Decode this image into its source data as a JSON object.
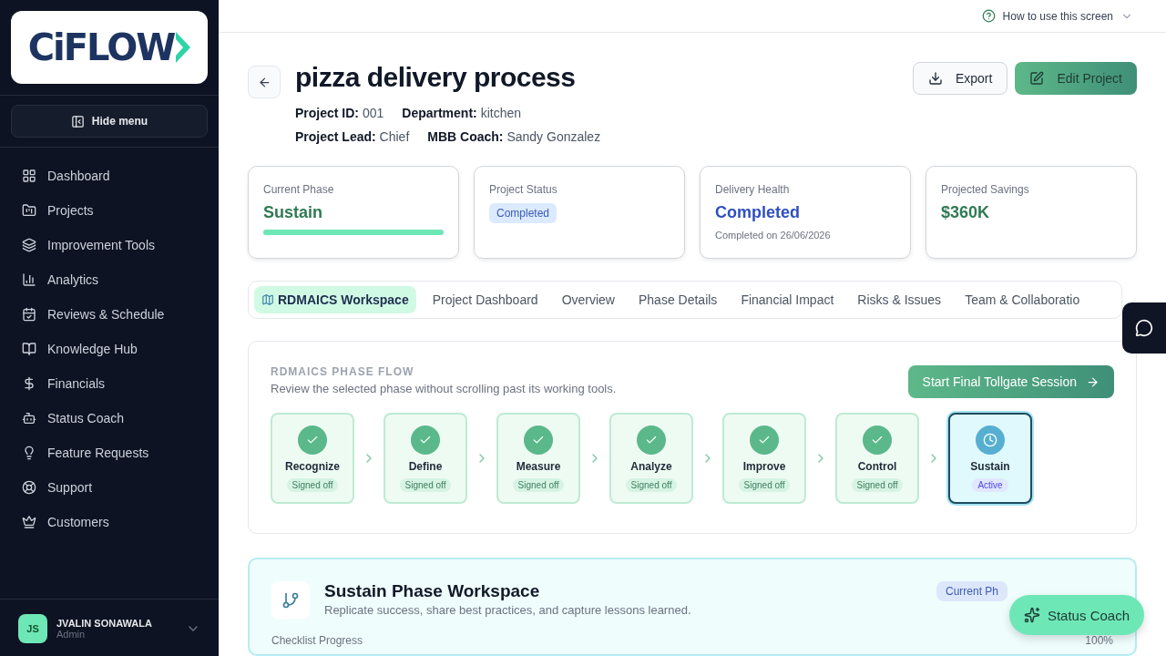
{
  "sidebar": {
    "logo": "CiFLOW",
    "hide_menu": "Hide menu",
    "items": [
      {
        "label": "Dashboard"
      },
      {
        "label": "Projects"
      },
      {
        "label": "Improvement Tools"
      },
      {
        "label": "Analytics"
      },
      {
        "label": "Reviews & Schedule"
      },
      {
        "label": "Knowledge Hub"
      },
      {
        "label": "Financials"
      },
      {
        "label": "Status Coach"
      },
      {
        "label": "Feature Requests"
      },
      {
        "label": "Support"
      },
      {
        "label": "Customers"
      }
    ],
    "user": {
      "initials": "JS",
      "name": "JVALIN SONAWALA",
      "role": "Admin"
    }
  },
  "topbar": {
    "help": "How to use this screen"
  },
  "project": {
    "title": "pizza delivery process",
    "meta": [
      [
        {
          "label": "Project ID:",
          "value": "001"
        },
        {
          "label": "Department:",
          "value": "kitchen"
        }
      ],
      [
        {
          "label": "Project Lead:",
          "value": "Chief"
        },
        {
          "label": "MBB Coach:",
          "value": "Sandy Gonzalez"
        }
      ]
    ],
    "export": "Export",
    "edit": "Edit Project"
  },
  "stats": [
    {
      "kind": "progress",
      "label": "Current Phase",
      "value": "Sustain",
      "level": 1
    },
    {
      "kind": "badge",
      "label": "Project Status",
      "value": "Completed"
    },
    {
      "kind": "health",
      "label": "Delivery Health",
      "value": "Completed",
      "note": "Completed on 26/06/2026"
    },
    {
      "kind": "money",
      "label": "Projected Savings",
      "value": "$360K"
    }
  ],
  "tabs": [
    {
      "label": "RDMAICS Workspace",
      "selected": true
    },
    {
      "label": "Project Dashboard",
      "selected": false
    },
    {
      "label": "Overview",
      "selected": false
    },
    {
      "label": "Phase Details",
      "selected": false
    },
    {
      "label": "Financial Impact",
      "selected": false
    },
    {
      "label": "Risks & Issues",
      "selected": false
    },
    {
      "label": "Team & Collaboratio",
      "selected": false
    }
  ],
  "phase_flow": {
    "heading": "RDMAICS PHASE FLOW",
    "subtitle": "Review the selected phase without scrolling past its working tools.",
    "action": "Start Final Tollgate Session",
    "phases": [
      {
        "name": "Recognize",
        "status": "Signed off",
        "selected": false
      },
      {
        "name": "Define",
        "status": "Signed off",
        "selected": false
      },
      {
        "name": "Measure",
        "status": "Signed off",
        "selected": false
      },
      {
        "name": "Analyze",
        "status": "Signed off",
        "selected": false
      },
      {
        "name": "Improve",
        "status": "Signed off",
        "selected": false
      },
      {
        "name": "Control",
        "status": "Signed off",
        "selected": false
      },
      {
        "name": "Sustain",
        "status": "Active",
        "selected": true
      }
    ]
  },
  "workspace": {
    "title": "Sustain Phase Workspace",
    "subtitle": "Replicate success, share best practices, and capture lessons learned.",
    "badge": "Current Ph",
    "progress_label": "Checklist Progress",
    "progress_value": "100%"
  },
  "floating": {
    "coach": "Status Coach"
  }
}
